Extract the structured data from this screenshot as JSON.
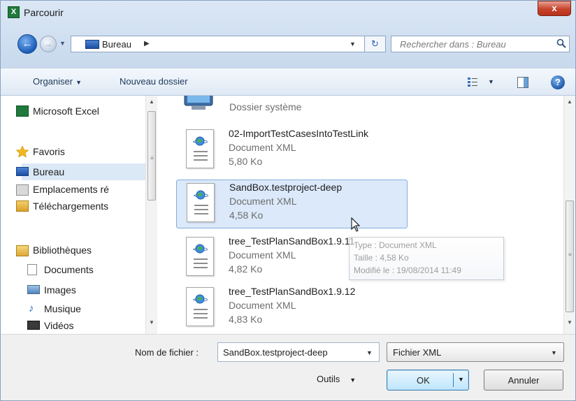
{
  "window": {
    "title": "Parcourir",
    "app_icon_letter": "X",
    "close_label": "x"
  },
  "navbar": {
    "back_label": "←",
    "forward_label": "→",
    "location": "Bureau",
    "path_separator": "▶",
    "search_placeholder": "Rechercher dans : Bureau"
  },
  "toolbar": {
    "organize_label": "Organiser",
    "new_folder_label": "Nouveau dossier",
    "help_label": "?"
  },
  "nav": {
    "items": [
      {
        "label": "Microsoft Excel",
        "icon": "excel-icon"
      },
      {
        "label": "Favoris",
        "icon": "star-icon"
      },
      {
        "label": "Bureau",
        "icon": "desktop-icon",
        "selected": true
      },
      {
        "label": "Emplacements ré",
        "icon": "recent-places-icon"
      },
      {
        "label": "Téléchargements",
        "icon": "downloads-icon"
      },
      {
        "label": "Bibliothèques",
        "icon": "libraries-icon"
      },
      {
        "label": "Documents",
        "icon": "documents-icon"
      },
      {
        "label": "Images",
        "icon": "images-icon"
      },
      {
        "label": "Musique",
        "icon": "music-icon"
      },
      {
        "label": "Vidéos",
        "icon": "videos-icon"
      }
    ]
  },
  "files": {
    "system_folder_type": "Dossier système",
    "items": [
      {
        "name": "02-ImportTestCasesIntoTestLink",
        "type": "Document XML",
        "size": "5,80 Ko"
      },
      {
        "name": "SandBox.testproject-deep",
        "type": "Document XML",
        "size": "4,58 Ko",
        "selected": true
      },
      {
        "name": "tree_TestPlanSandBox1.9.11",
        "type": "Document XML",
        "size": "4,82 Ko"
      },
      {
        "name": "tree_TestPlanSandBox1.9.12",
        "type": "Document XML",
        "size": "4,83 Ko"
      }
    ]
  },
  "tooltip": {
    "type_line": "Type : Document XML",
    "size_line": "Taille : 4,58 Ko",
    "modified_line": "Modifié le : 19/08/2014 11:49"
  },
  "bottom": {
    "filename_label": "Nom de fichier :",
    "filename_value": "SandBox.testproject-deep",
    "filetype_value": "Fichier XML",
    "tools_label": "Outils",
    "ok_label": "OK",
    "cancel_label": "Annuler"
  }
}
